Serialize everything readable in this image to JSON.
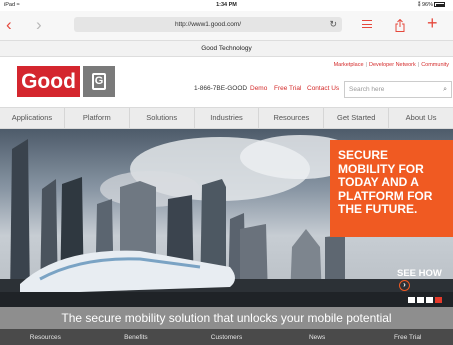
{
  "status_bar": {
    "device": "iPad ≈",
    "time": "1:34 PM",
    "battery": "⁑ 96%"
  },
  "browser": {
    "url": "http://www1.good.com/",
    "page_title": "Good Technology"
  },
  "utility_links": [
    "Marketplace",
    "Developer Network",
    "Community"
  ],
  "logo": {
    "text": "Good",
    "mark": "G",
    "brand_red": "#d4262e",
    "brand_grey": "#7a7a7a"
  },
  "header": {
    "phone": "1-866-7BE-GOOD",
    "links": [
      "Demo",
      "Free Trial",
      "Contact Us"
    ],
    "search_placeholder": "Search here"
  },
  "main_nav": [
    "Applications",
    "Platform",
    "Solutions",
    "Industries",
    "Resources",
    "Get Started",
    "About Us"
  ],
  "hero": {
    "headline": "SECURE MOBILITY FOR TODAY AND A PLATFORM FOR THE FUTURE.",
    "cta": "SEE HOW",
    "accent": "#f05a22",
    "slides": 4,
    "active_slide": 4
  },
  "tagline": "The secure mobility solution that unlocks your mobile potential",
  "footer_nav": [
    "Resources",
    "Benefits",
    "Customers",
    "News",
    "Free Trial"
  ]
}
